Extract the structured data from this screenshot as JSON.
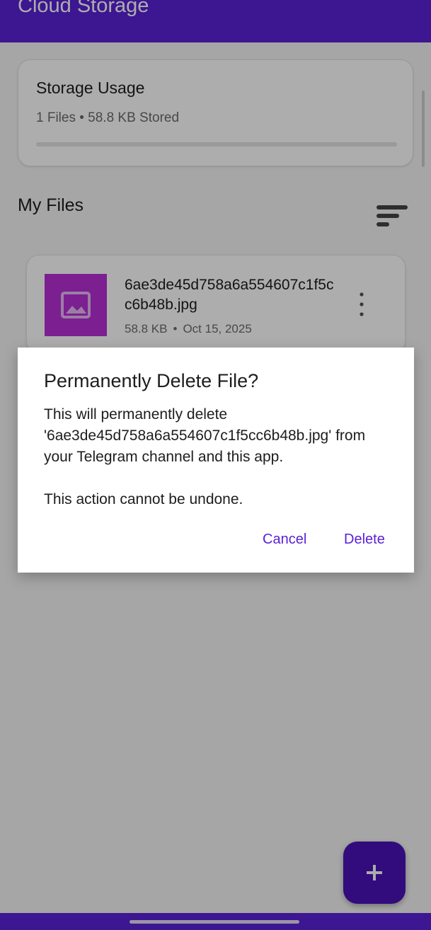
{
  "app_bar": {
    "title": "Cloud Storage"
  },
  "storage": {
    "title": "Storage Usage",
    "summary": "1 Files • 58.8 KB Stored",
    "usage_fraction": 0.0
  },
  "files_section": {
    "title": "My Files",
    "sort_icon": "sort-icon"
  },
  "files": [
    {
      "name": "6ae3de45d758a6a554607c1f5cc6b48b.jpg",
      "size": "58.8 KB",
      "separator": "•",
      "date": "Oct 15, 2025",
      "thumbnail_icon": "image-icon",
      "menu_icon": "more-vertical-icon"
    }
  ],
  "dialog": {
    "title": "Permanently Delete File?",
    "body_line1": "This will permanently delete '6ae3de45d758a6a554607c1f5cc6b48b.jpg' from your Telegram channel and this app.",
    "body_line2": "This action cannot be undone.",
    "cancel_label": "Cancel",
    "delete_label": "Delete"
  },
  "fab": {
    "icon": "plus-icon"
  },
  "colors": {
    "primary": "#5b21d6",
    "fab": "#4a12b8",
    "thumbnail": "#b52fd6",
    "scrim": "rgba(0,0,0,0.32)"
  }
}
